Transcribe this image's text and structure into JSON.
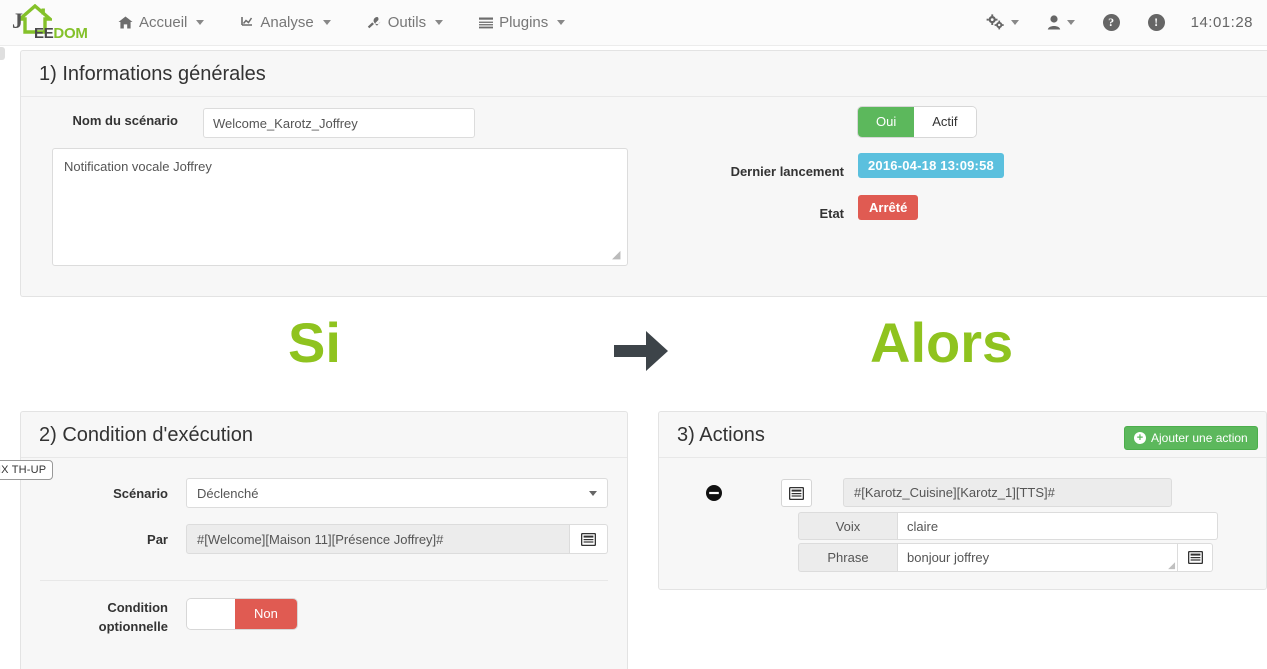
{
  "navbar": {
    "brand": {
      "dark": "EE",
      "green": "DOM",
      "icon": "house-logo-icon"
    },
    "items": [
      {
        "label": "Accueil",
        "icon": "home-icon"
      },
      {
        "label": "Analyse",
        "icon": "chart-icon"
      },
      {
        "label": "Outils",
        "icon": "wrench-icon"
      },
      {
        "label": "Plugins",
        "icon": "list-icon"
      }
    ],
    "right": {
      "gears_icon": "gears-icon",
      "user_icon": "user-icon",
      "help_icon": "question-circle-icon",
      "info_icon": "exclamation-circle-icon",
      "clock": "14:01:28"
    }
  },
  "general": {
    "title": "1) Informations générales",
    "name_label": "Nom du scénario",
    "name_value": "Welcome_Karotz_Joffrey",
    "description_value": "Notification vocale Joffrey",
    "description_placeholder": "",
    "active_toggle": {
      "on_label": "Oui",
      "off_label": "Actif",
      "selected": "Oui"
    },
    "last_run_label": "Dernier lancement",
    "last_run_value": "2016-04-18 13:09:58",
    "state_label": "Etat",
    "state_value": "Arrêté"
  },
  "flow": {
    "si": "Si",
    "alors": "Alors",
    "arrow_icon": "arrow-right-icon"
  },
  "condition": {
    "title": "2) Condition d'exécution",
    "scenario_label": "Scénario",
    "scenario_value": "Déclenché",
    "par_label": "Par",
    "par_value": "#[Welcome][Maison 11][Présence Joffrey]#",
    "par_button_icon": "list-window-icon",
    "optional_label_line1": "Condition",
    "optional_label_line2": "optionnelle",
    "optional_toggle": {
      "blank_label": "",
      "off_label": "Non",
      "selected": "Non"
    }
  },
  "actions": {
    "title": "3) Actions",
    "add_button": "Ajouter une action",
    "add_button_icon": "plus-circle-icon",
    "row": {
      "remove_icon": "minus-circle-icon",
      "picker_icon": "list-window-icon",
      "command_value": "#[Karotz_Cuisine][Karotz_1][TTS]#",
      "options": [
        {
          "key": "Voix",
          "value": "claire",
          "has_button": false
        },
        {
          "key": "Phrase",
          "value": "bonjour joffrey",
          "has_button": true,
          "button_icon": "list-window-icon"
        }
      ]
    }
  },
  "tooltip": {
    "edge_badge": "NX TH-UP"
  },
  "colors": {
    "brand_green": "#84c12a",
    "flow_green": "#8fc31f",
    "success": "#5cb85c",
    "danger": "#e05b52",
    "info": "#5bc0de",
    "panel_bg": "#f7f7f7",
    "panel_border": "#e3e3e3"
  }
}
